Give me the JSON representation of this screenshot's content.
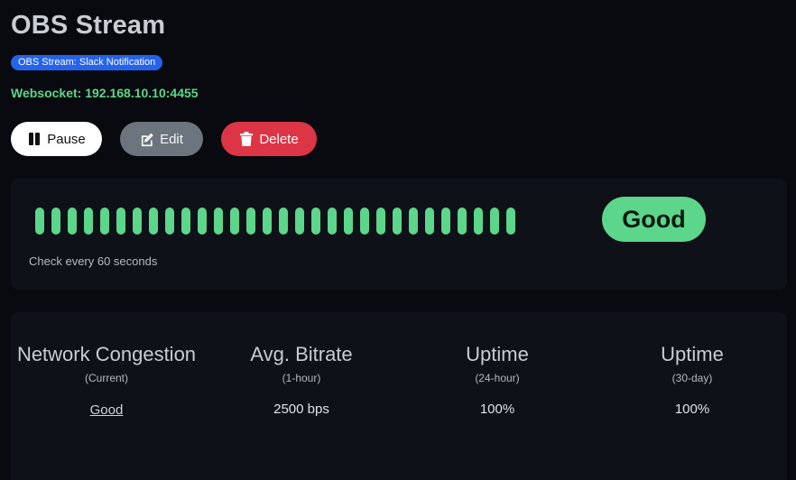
{
  "page": {
    "title": "OBS Stream",
    "tag": "OBS Stream: Slack Notification",
    "websocket": "Websocket: 192.168.10.10:4455"
  },
  "buttons": {
    "pause": "Pause",
    "edit": "Edit",
    "delete": "Delete"
  },
  "heartbeat": {
    "beat_count": 30,
    "beat_color": "#5cd68a",
    "interval_text": "Check every 60 seconds",
    "status": "Good"
  },
  "stats": [
    {
      "title": "Network Congestion",
      "sub": "(Current)",
      "value": "Good"
    },
    {
      "title": "Avg. Bitrate",
      "sub": "(1-hour)",
      "value": "2500 bps"
    },
    {
      "title": "Uptime",
      "sub": "(24-hour)",
      "value": "100%"
    },
    {
      "title": "Uptime",
      "sub": "(30-day)",
      "value": "100%"
    }
  ],
  "colors": {
    "accent_green": "#5cd68a",
    "tag_blue": "#2563eb",
    "delete_red": "#dc3545",
    "edit_gray": "#6c757d"
  },
  "icons": {
    "pause": "pause-icon",
    "edit": "edit-icon",
    "delete": "trash-icon"
  }
}
